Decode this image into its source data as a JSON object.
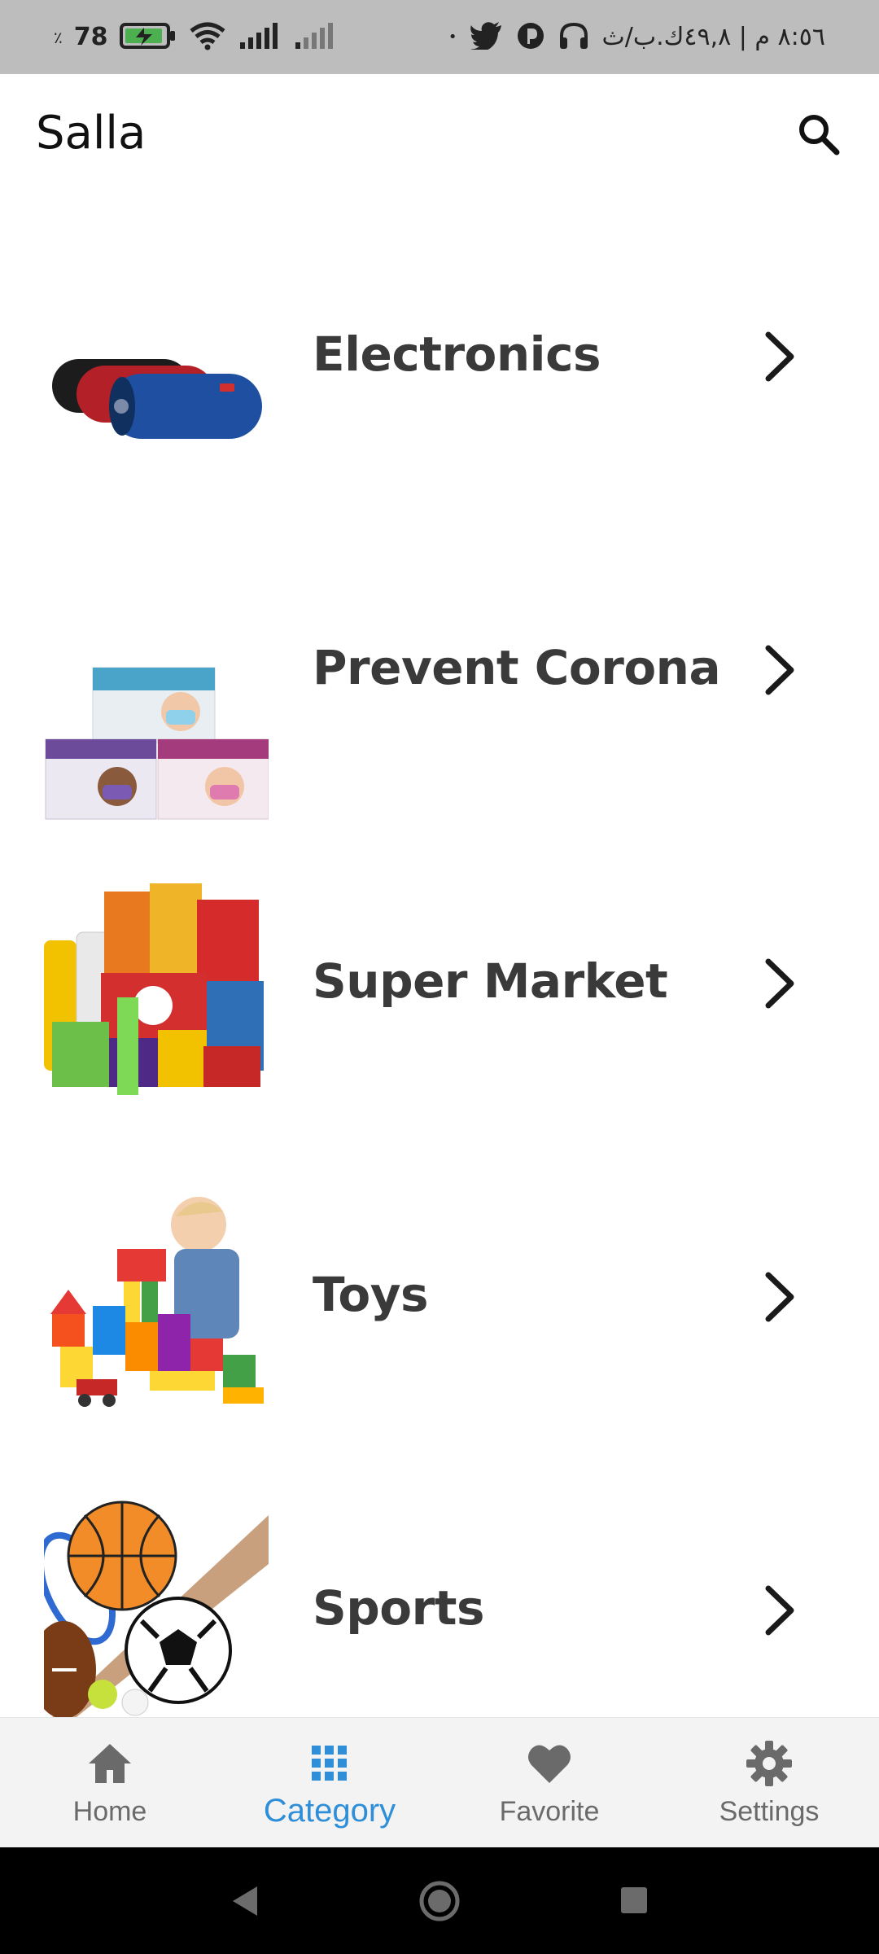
{
  "status_bar": {
    "battery_percent": "78",
    "percent_sign": "٪",
    "time_text": "٨:٥٦ م | ٤٩,٨ك.ب/ث",
    "dot": "•"
  },
  "app_bar": {
    "title": "Salla",
    "search_icon": "search-icon"
  },
  "categories": [
    {
      "label": "Electronics",
      "image": "speakers-image"
    },
    {
      "label": "Prevent Corona",
      "image": "face-masks-image"
    },
    {
      "label": "Super Market",
      "image": "groceries-image"
    },
    {
      "label": "Toys",
      "image": "toy-blocks-image"
    },
    {
      "label": "Sports",
      "image": "sports-balls-image"
    }
  ],
  "bottom_nav": {
    "items": [
      {
        "label": "Home",
        "icon": "home-icon",
        "active": false
      },
      {
        "label": "Category",
        "icon": "grid-icon",
        "active": true
      },
      {
        "label": "Favorite",
        "icon": "heart-icon",
        "active": false
      },
      {
        "label": "Settings",
        "icon": "gear-icon",
        "active": false
      }
    ]
  },
  "colors": {
    "accent": "#2e8fd8",
    "inactive": "#6a6a6a",
    "label": "#3a3a3a",
    "status_bar_bg": "#bdbdbd",
    "bottom_nav_bg": "#f3f3f3"
  }
}
